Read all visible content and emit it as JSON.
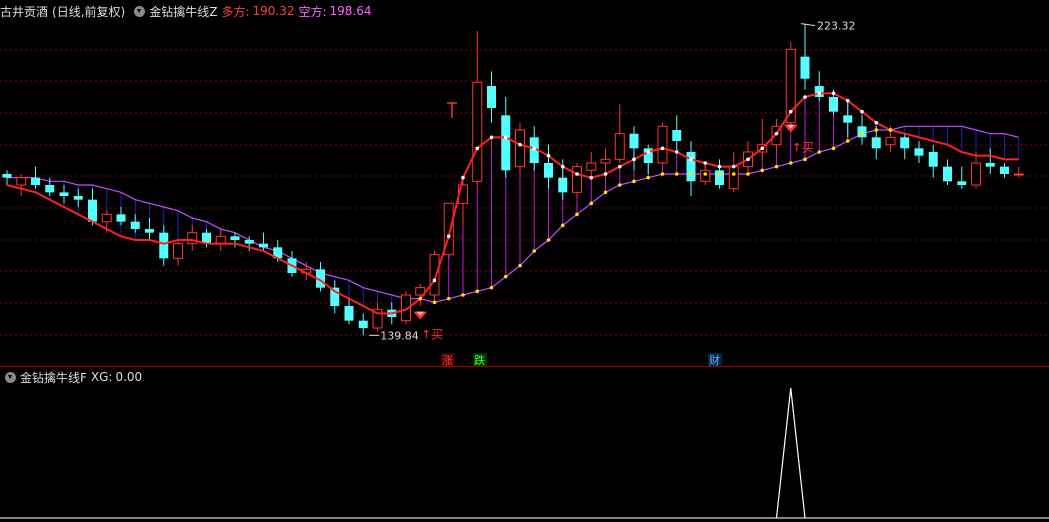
{
  "header": {
    "stock_name": "古井贡酒",
    "period": "(日线,前复权)",
    "indicator": "金钻擒牛线Z",
    "long_label": "多方:",
    "long_value": "190.32",
    "short_label": "空方:",
    "short_value": "198.64"
  },
  "sub_header": {
    "indicator": "金钻擒牛线F",
    "xg_label": "XG:",
    "xg_value": "0.00"
  },
  "annotations": {
    "high_price": "223.32",
    "low_price": "139.84",
    "buy_label": "↑买",
    "tag_zhang": "涨",
    "tag_die": "跌",
    "tag_cai": "财"
  },
  "colors": {
    "bg": "#000000",
    "up": "#ff3333",
    "down": "#54ffff",
    "long_line": "#ff2020",
    "short_line": "#c050ff",
    "fill_bull": "#c020d0",
    "fill_bear": "#2020c0",
    "grid": "#800000",
    "header_title": "#dddddd",
    "long_text": "#ff4040",
    "short_text": "#ff66ff"
  },
  "chart_data": {
    "type": "candlestick",
    "ylim": [
      136,
      226
    ],
    "ohlc": [
      [
        184,
        185,
        181,
        183
      ],
      [
        181,
        184,
        178,
        183
      ],
      [
        183,
        186,
        180,
        181
      ],
      [
        181,
        183,
        178,
        179
      ],
      [
        179,
        181,
        176,
        178
      ],
      [
        178,
        180,
        175,
        177
      ],
      [
        177,
        180,
        170,
        171
      ],
      [
        171,
        174,
        168,
        173
      ],
      [
        173,
        175,
        170,
        171
      ],
      [
        171,
        173,
        168,
        169
      ],
      [
        169,
        172,
        166,
        168
      ],
      [
        168,
        170,
        159,
        161
      ],
      [
        161,
        166,
        159,
        165
      ],
      [
        165,
        170,
        163,
        168
      ],
      [
        168,
        169,
        164,
        165
      ],
      [
        165,
        169,
        163,
        167
      ],
      [
        167,
        168,
        164,
        166
      ],
      [
        166,
        167,
        163,
        165
      ],
      [
        165,
        168,
        163,
        164
      ],
      [
        164,
        166,
        160,
        161
      ],
      [
        161,
        163,
        156,
        157
      ],
      [
        157,
        160,
        155,
        158
      ],
      [
        158,
        160,
        152,
        153
      ],
      [
        153,
        155,
        146,
        148
      ],
      [
        148,
        150,
        143,
        144
      ],
      [
        144,
        146,
        140,
        142
      ],
      [
        142,
        149,
        141,
        147
      ],
      [
        147,
        149,
        143,
        145
      ],
      [
        144,
        152,
        143,
        151
      ],
      [
        151,
        154,
        148,
        153
      ],
      [
        151,
        163,
        150,
        162
      ],
      [
        162,
        176,
        161,
        176
      ],
      [
        176,
        183,
        170,
        181
      ],
      [
        182,
        223,
        181,
        209
      ],
      [
        208,
        212,
        198,
        202
      ],
      [
        200,
        205,
        183,
        185
      ],
      [
        186,
        198,
        184,
        196
      ],
      [
        194,
        197,
        185,
        187
      ],
      [
        187,
        192,
        180,
        183
      ],
      [
        183,
        188,
        177,
        179
      ],
      [
        179,
        187,
        178,
        186
      ],
      [
        185,
        190,
        182,
        187
      ],
      [
        187,
        191,
        183,
        188
      ],
      [
        188,
        203,
        187,
        195
      ],
      [
        195,
        197,
        185,
        191
      ],
      [
        191,
        192,
        184,
        187
      ],
      [
        187,
        198,
        186,
        197
      ],
      [
        196,
        200,
        190,
        193
      ],
      [
        190,
        193,
        178,
        182
      ],
      [
        182,
        187,
        181,
        185
      ],
      [
        185,
        188,
        180,
        181
      ],
      [
        180,
        190,
        179,
        186
      ],
      [
        186,
        193,
        184,
        190
      ],
      [
        190,
        199,
        188,
        192
      ],
      [
        192,
        199,
        190,
        197
      ],
      [
        198,
        220,
        196,
        218
      ],
      [
        216,
        225,
        207,
        210
      ],
      [
        208,
        212,
        204,
        205
      ],
      [
        205,
        207,
        200,
        201
      ],
      [
        200,
        204,
        194,
        198
      ],
      [
        197,
        200,
        192,
        194
      ],
      [
        194,
        197,
        188,
        191
      ],
      [
        192,
        197,
        190,
        194
      ],
      [
        194,
        195,
        188,
        191
      ],
      [
        191,
        193,
        187,
        189
      ],
      [
        190,
        192,
        183,
        186
      ],
      [
        186,
        188,
        181,
        182
      ],
      [
        182,
        186,
        180,
        181
      ],
      [
        181,
        190,
        180,
        187
      ],
      [
        187,
        191,
        184,
        186
      ],
      [
        186,
        187,
        183,
        184
      ],
      [
        184,
        186,
        183,
        184
      ]
    ],
    "long_line": [
      181,
      180,
      179,
      177,
      175,
      173,
      171,
      169,
      167,
      166,
      166,
      165,
      166,
      166,
      165,
      165,
      165,
      164,
      163,
      161,
      159,
      157,
      155,
      152,
      150,
      148,
      146,
      146,
      147,
      150,
      155,
      167,
      183,
      191,
      194,
      194,
      192,
      191,
      189,
      186,
      184,
      183,
      184,
      186,
      188,
      190,
      191,
      190,
      188,
      187,
      186,
      186,
      188,
      191,
      195,
      201,
      205,
      206,
      206,
      204,
      201,
      198,
      196,
      195,
      194,
      193,
      192,
      190,
      189,
      189,
      188,
      188
    ],
    "short_line": [
      183,
      183,
      183,
      182,
      182,
      181,
      181,
      180,
      179,
      177,
      176,
      175,
      174,
      172,
      171,
      169,
      168,
      166,
      164,
      163,
      161,
      159,
      157,
      156,
      155,
      153,
      152,
      151,
      150,
      150,
      149,
      150,
      151,
      152,
      153,
      156,
      159,
      163,
      166,
      170,
      173,
      176,
      179,
      181,
      182,
      183,
      184,
      184,
      184,
      184,
      184,
      184,
      184,
      185,
      186,
      187,
      188,
      190,
      191,
      193,
      195,
      196,
      196,
      197,
      197,
      197,
      197,
      197,
      196,
      195,
      195,
      194
    ],
    "buy_signal_index": 55,
    "xg_values": [
      0,
      0,
      0,
      0,
      0,
      0,
      0,
      0,
      0,
      0,
      0,
      0,
      0,
      0,
      0,
      0,
      0,
      0,
      0,
      0,
      0,
      0,
      0,
      0,
      0,
      0,
      0,
      0,
      0,
      0,
      0,
      0,
      0,
      0,
      0,
      0,
      0,
      0,
      0,
      0,
      0,
      0,
      0,
      0,
      0,
      0,
      0,
      0,
      0,
      0,
      0,
      0,
      0,
      0,
      0,
      1,
      0,
      0,
      0,
      0,
      0,
      0,
      0,
      0,
      0,
      0,
      0,
      0,
      0,
      0,
      0,
      0
    ],
    "xg_ylim": [
      0,
      1
    ]
  }
}
